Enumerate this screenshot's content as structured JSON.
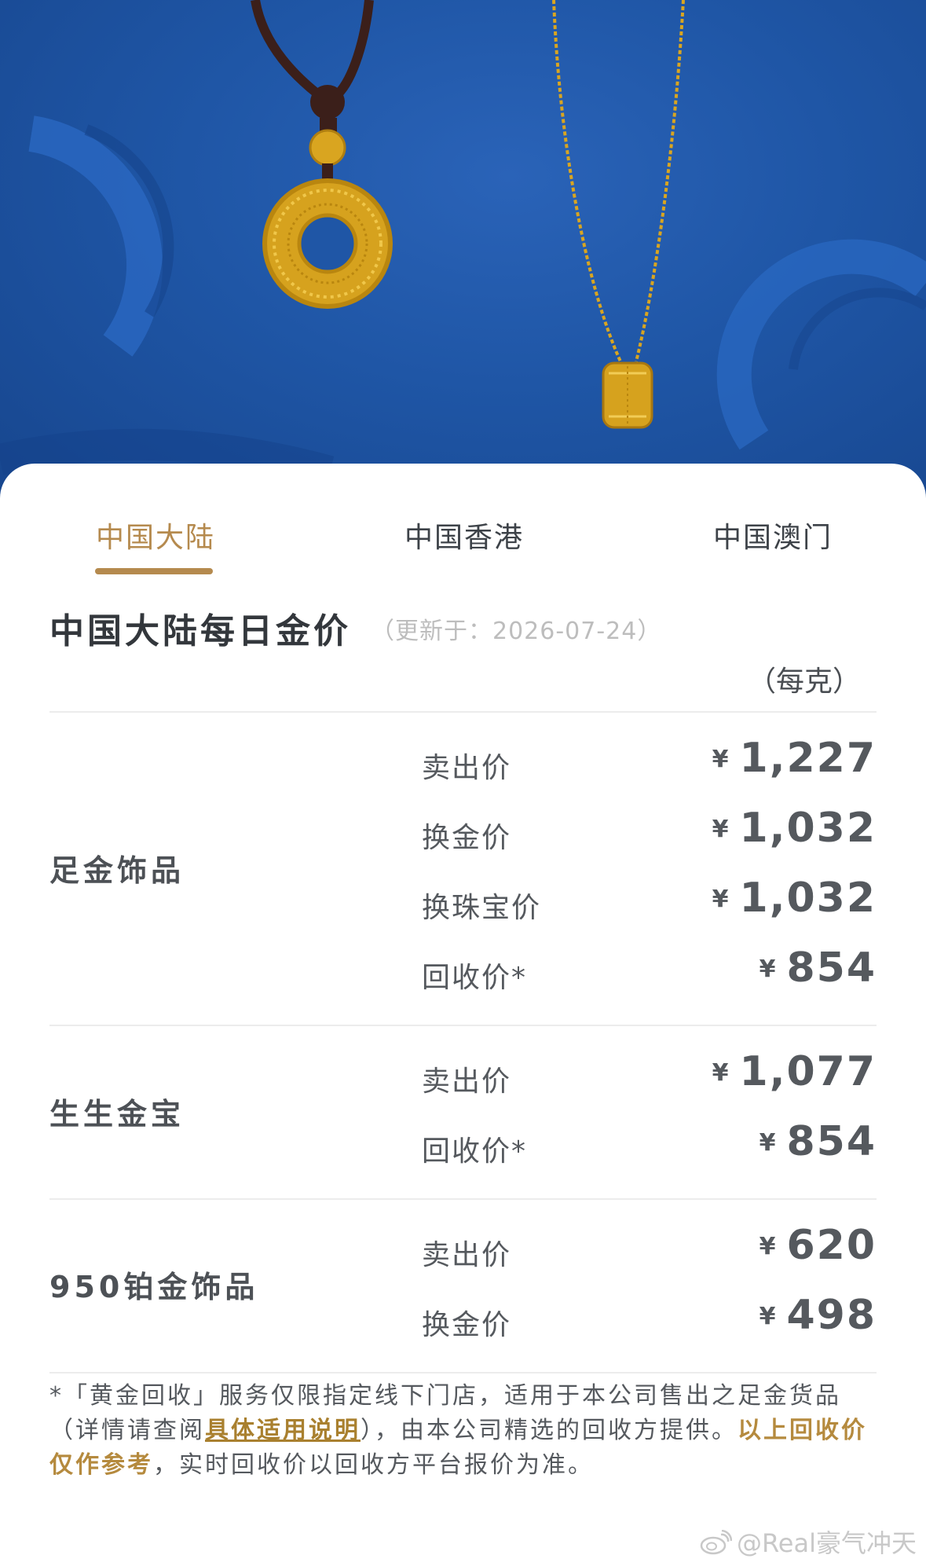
{
  "tabs": [
    {
      "label": "中国大陆",
      "active": true
    },
    {
      "label": "中国香港",
      "active": false
    },
    {
      "label": "中国澳门",
      "active": false
    }
  ],
  "header": {
    "title": "中国大陆每日金价",
    "updated": "（更新于：2026-07-24）",
    "unit": "（每克）"
  },
  "currency_symbol": "¥",
  "groups": [
    {
      "name": "足金饰品",
      "rows": [
        {
          "label": "卖出价",
          "value": "1,227"
        },
        {
          "label": "换金价",
          "value": "1,032"
        },
        {
          "label": "换珠宝价",
          "value": "1,032"
        },
        {
          "label": "回收价*",
          "value": "854"
        }
      ]
    },
    {
      "name": "生生金宝",
      "rows": [
        {
          "label": "卖出价",
          "value": "1,077"
        },
        {
          "label": "回收价*",
          "value": "854"
        }
      ]
    },
    {
      "name": "950铂金饰品",
      "rows": [
        {
          "label": "卖出价",
          "value": "620"
        },
        {
          "label": "换金价",
          "value": "498"
        }
      ]
    }
  ],
  "footnote": {
    "part1": "*「黄金回收」服务仅限指定线下门店，适用于本公司售出之足金货品（详情请查阅",
    "link": "具体适用说明",
    "part2": "），由本公司精选的回收方提供。",
    "highlight": "以上回收价仅作参考",
    "part3": "，实时回收价以回收方平台报价为准。"
  },
  "watermark": "@Real豪气冲天",
  "colors": {
    "accent": "#b58a4e",
    "banner": "#1f56a6",
    "text": "#55595e"
  }
}
